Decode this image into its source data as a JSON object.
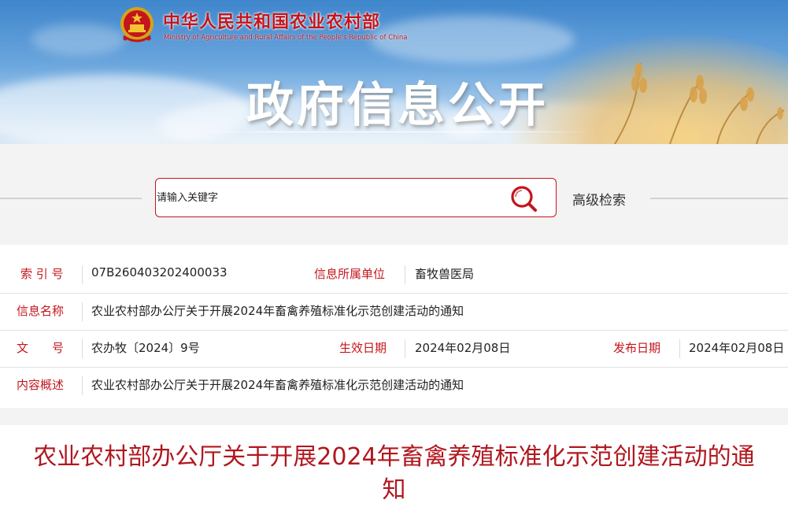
{
  "header": {
    "ministry_cn": "中华人民共和国农业农村部",
    "ministry_en": "Ministry of Agriculture and Rural Affairs of the People's Republic of China",
    "section_title": "政府信息公开"
  },
  "search": {
    "placeholder": "请输入关键字",
    "search_icon": "magnifier-icon",
    "advanced_label": "高级检索"
  },
  "meta": {
    "index_label": "索 引 号",
    "index_value": "07B260403202400033",
    "unit_label": "信息所属单位",
    "unit_value": "畜牧兽医局",
    "name_label": "信息名称",
    "name_value": "农业农村部办公厅关于开展2024年畜禽养殖标准化示范创建活动的通知",
    "doc_label": "文　　号",
    "doc_value": "农办牧〔2024〕9号",
    "effective_label": "生效日期",
    "effective_value": "2024年02月08日",
    "publish_label": "发布日期",
    "publish_value": "2024年02月08日",
    "summary_label": "内容概述",
    "summary_value": "农业农村部办公厅关于开展2024年畜禽养殖标准化示范创建活动的通知"
  },
  "article": {
    "title": "农业农村部办公厅关于开展2024年畜禽养殖标准化示范创建活动的通知"
  },
  "colors": {
    "accent": "#c4151c",
    "title": "#b0181f",
    "panel": "#f3f3f3"
  }
}
